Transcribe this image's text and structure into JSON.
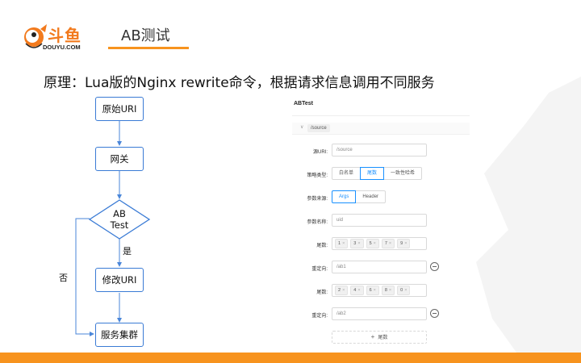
{
  "brand": {
    "logo_text": "斗鱼",
    "logo_sub": "DOUYU.COM",
    "accent": "#f7931e"
  },
  "section_title": "AB测试",
  "subtitle": "原理：Lua版的Nginx rewrite命令，根据请求信息调用不同服务",
  "flow": {
    "node_source": "原始URI",
    "node_gateway": "网关",
    "node_decision_line1": "AB",
    "node_decision_line2": "Test",
    "node_modify": "修改URI",
    "node_cluster": "服务集群",
    "yes_label": "是",
    "no_label": "否"
  },
  "panel": {
    "title": "ABTest",
    "path_tag": "/source",
    "source_uri_label": "源URI:",
    "source_uri_value": "/source",
    "strategy_label": "策略类型:",
    "strategy_options": [
      "白名单",
      "尾数",
      "一致性哈希"
    ],
    "strategy_selected": "尾数",
    "param_source_label": "参数来源:",
    "param_source_options": [
      "Args",
      "Header"
    ],
    "param_source_selected": "Args",
    "param_name_label": "参数名称:",
    "param_name_value": "uid",
    "rule1": {
      "tail_label": "尾数:",
      "tails": [
        "1",
        "3",
        "5",
        "7",
        "9"
      ],
      "redirect_label": "重定向:",
      "redirect_value": "/ab1"
    },
    "rule2": {
      "tail_label": "尾数:",
      "tails": [
        "2",
        "4",
        "6",
        "8",
        "0"
      ],
      "redirect_label": "重定向:",
      "redirect_value": "/ab2"
    },
    "add_label": "尾数"
  }
}
